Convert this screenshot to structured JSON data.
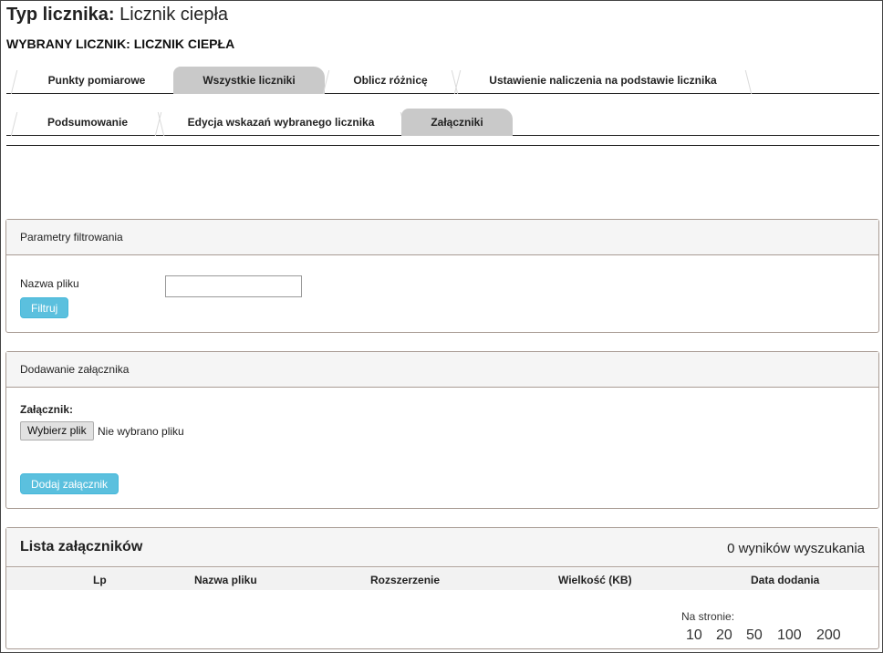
{
  "header": {
    "title_label": "Typ licznika:",
    "title_value": "Licznik ciepła",
    "subtitle": "WYBRANY LICZNIK: LICZNIK CIEPŁA"
  },
  "tabs_row1": [
    {
      "label": "Punkty pomiarowe",
      "active": false
    },
    {
      "label": "Wszystkie liczniki",
      "active": true
    },
    {
      "label": "Oblicz różnicę",
      "active": false
    },
    {
      "label": "Ustawienie naliczenia na podstawie licznika",
      "active": false
    }
  ],
  "tabs_row2": [
    {
      "label": "Podsumowanie",
      "active": false
    },
    {
      "label": "Edycja wskazań wybranego licznika",
      "active": false
    },
    {
      "label": "Załączniki",
      "active": true
    }
  ],
  "filter_panel": {
    "title": "Parametry filtrowania",
    "field_label": "Nazwa pliku",
    "field_value": "",
    "button": "Filtruj"
  },
  "attach_panel": {
    "title": "Dodawanie załącznika",
    "field_label": "Załącznik:",
    "choose_button": "Wybierz plik",
    "no_file_text": "Nie wybrano pliku",
    "add_button": "Dodaj załącznik"
  },
  "list_panel": {
    "title": "Lista załączników",
    "results": "0 wyników wyszukania",
    "columns": [
      "Lp",
      "Nazwa pliku",
      "Rozszerzenie",
      "Wielkość (KB)",
      "Data dodania"
    ],
    "per_page_label": "Na stronie:",
    "per_page_options": [
      "10",
      "20",
      "50",
      "100",
      "200"
    ]
  },
  "colors": {
    "accent_button": "#5bc0de",
    "active_tab": "#c9c9c9",
    "panel_border": "#a89b93"
  }
}
